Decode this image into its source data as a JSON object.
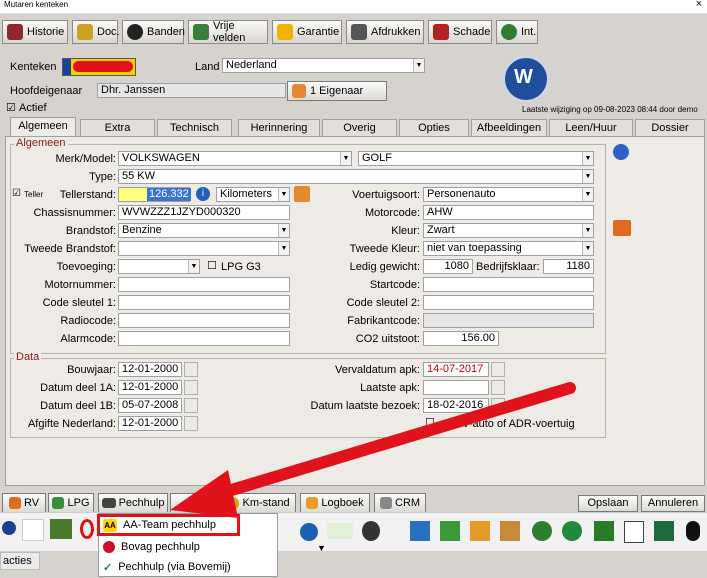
{
  "window": {
    "title": "Mutaren kenteken",
    "close": "×"
  },
  "toolbar": [
    {
      "label": "Historie",
      "icon": "history-icon",
      "color": "#8b2a2a"
    },
    {
      "label": "Doc.",
      "icon": "document-icon",
      "color": "#c9a227"
    },
    {
      "label": "Banden",
      "icon": "tire-icon",
      "color": "#222222"
    },
    {
      "label": "Vrije velden",
      "icon": "checklist-icon",
      "color": "#3b7d3b"
    },
    {
      "label": "Garantie",
      "icon": "star-icon",
      "color": "#f0b400"
    },
    {
      "label": "Afdrukken",
      "icon": "print-icon",
      "color": "#555555"
    },
    {
      "label": "Schade",
      "icon": "damaged-car-icon",
      "color": "#b22222"
    },
    {
      "label": "Int.",
      "icon": "stopwatch-icon",
      "color": "#2e7d32"
    }
  ],
  "header": {
    "kenteken_label": "Kenteken",
    "land_label": "Land",
    "land_value": "Nederland",
    "hoofdeigenaar_label": "Hoofdeigenaar",
    "hoofdeigenaar_value": "Dhr. Janssen",
    "eigenaar_button": "1 Eigenaar",
    "actief_label": "Actief",
    "brand_logo": "volkswagen-logo-icon",
    "last_change": "Laatste wijziging op 09-08-2023 08:44 door demo"
  },
  "tabs": [
    "Algemeen",
    "Extra",
    "Technisch",
    "Herinnering",
    "Overig",
    "Opties",
    "Afbeeldingen",
    "Leen/Huur",
    "Dossier"
  ],
  "algemeen": {
    "title": "Algemeen",
    "merk_model_label": "Merk/Model:",
    "merk": "VOLKSWAGEN",
    "model": "GOLF",
    "type_label": "Type:",
    "type": "55 KW",
    "teller_label": "Teller",
    "tellerstand_label": "Tellerstand:",
    "tellerstand": "126.332",
    "teller_unit": "Kilometers",
    "voertuigsoort_label": "Voertuigsoort:",
    "voertuigsoort": "Personenauto",
    "chassis_label": "Chassisnummer:",
    "chassis": "WVWZZZ1JZYD000320",
    "motorcode_label": "Motorcode:",
    "motorcode": "AHW",
    "brandstof_label": "Brandstof:",
    "brandstof": "Benzine",
    "kleur_label": "Kleur:",
    "kleur": "Zwart",
    "tweede_brandstof_label": "Tweede Brandstof:",
    "tweede_brandstof": "",
    "tweede_kleur_label": "Tweede Kleur:",
    "tweede_kleur": "niet van toepassing",
    "toevoeging_label": "Toevoeging:",
    "toevoeging": "",
    "lpg_label": "LPG G3",
    "ledig_label": "Ledig gewicht:",
    "ledig": "1080",
    "bedrijfsklaar_label": "Bedrijfsklaar:",
    "bedrijfsklaar": "1180",
    "motornummer_label": "Motornummer:",
    "motornummer": "",
    "startcode_label": "Startcode:",
    "startcode": "",
    "codesleutel1_label": "Code sleutel 1:",
    "codesleutel1": "",
    "codesleutel2_label": "Code sleutel 2:",
    "codesleutel2": "",
    "radiocode_label": "Radiocode:",
    "radiocode": "",
    "fabrikantcode_label": "Fabrikantcode:",
    "fabrikantcode": "",
    "alarmcode_label": "Alarmcode:",
    "alarmcode": "",
    "co2_label": "CO2 uitstoot:",
    "co2": "156.00"
  },
  "data_section": {
    "title": "Data",
    "bouwjaar_label": "Bouwjaar:",
    "bouwjaar": "12-01-2000",
    "deel1a_label": "Datum deel 1A:",
    "deel1a": "12-01-2000",
    "deel1b_label": "Datum deel 1B:",
    "deel1b": "05-07-2008",
    "afgifte_label": "Afgifte Nederland:",
    "afgifte": "12-01-2000",
    "apk_label": "Vervaldatum apk:",
    "apk": "14-07-2017",
    "laatste_apk_label": "Laatste apk:",
    "laatste_apk": "",
    "bezoek_label": "Datum laatste bezoek:",
    "bezoek": "18-02-2016",
    "adr_label": "8V-auto of ADR-voertuig"
  },
  "bottom_bar": [
    {
      "label": "RV",
      "icon": "rdw-icon"
    },
    {
      "label": "LPG",
      "icon": "fuel-pump-icon"
    },
    {
      "label": "Pechhulp",
      "icon": "tow-truck-icon"
    },
    {
      "label": "Km-stand",
      "icon": "gauge-icon"
    },
    {
      "label": "Logboek",
      "icon": "logbook-icon"
    },
    {
      "label": "CRM",
      "icon": "handshake-icon"
    }
  ],
  "actions": {
    "save": "Opslaan",
    "cancel": "Annuleren"
  },
  "popup_menu": [
    {
      "label": "AA-Team pechhulp",
      "icon": "aa-logo-icon"
    },
    {
      "label": "Bovag pechhulp",
      "icon": "bovag-logo-icon"
    },
    {
      "label": "Pechhulp (via Bovemij)",
      "icon": "check-icon"
    }
  ],
  "taskbar_label": "acties",
  "colors": {
    "highlight": "#e0131b",
    "selection": "#3874d8",
    "date_red": "#c00000",
    "yellow": "#ffff80"
  }
}
